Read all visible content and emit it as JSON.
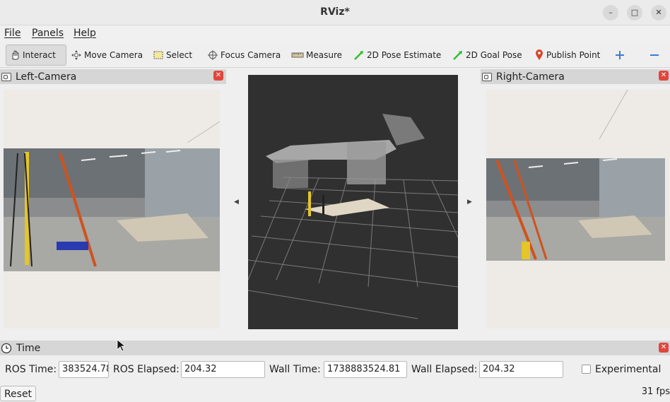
{
  "window": {
    "title": "RViz*"
  },
  "menu": [
    "File",
    "Panels",
    "Help"
  ],
  "toolbar": {
    "interact": "Interact",
    "move_camera": "Move Camera",
    "select": "Select",
    "focus_camera": "Focus Camera",
    "measure": "Measure",
    "pose_estimate": "2D Pose Estimate",
    "goal_pose": "2D Goal Pose",
    "publish_point": "Publish Point"
  },
  "panels": {
    "left_camera": "Left-Camera",
    "right_camera": "Right-Camera",
    "time": "Time"
  },
  "time": {
    "ros_time_label": "ROS Time:",
    "ros_time_value": "383524.78",
    "ros_elapsed_label": "ROS Elapsed:",
    "ros_elapsed_value": "204.32",
    "wall_time_label": "Wall Time:",
    "wall_time_value": "1738883524.81",
    "wall_elapsed_label": "Wall Elapsed:",
    "wall_elapsed_value": "204.32",
    "experimental_label": "Experimental",
    "experimental_checked": false
  },
  "reset_label": "Reset",
  "fps": "31 fps",
  "colors": {
    "close_button": "#e0463c",
    "viewport_bg": "#303030",
    "pose_arrow": "#2ec12e"
  }
}
